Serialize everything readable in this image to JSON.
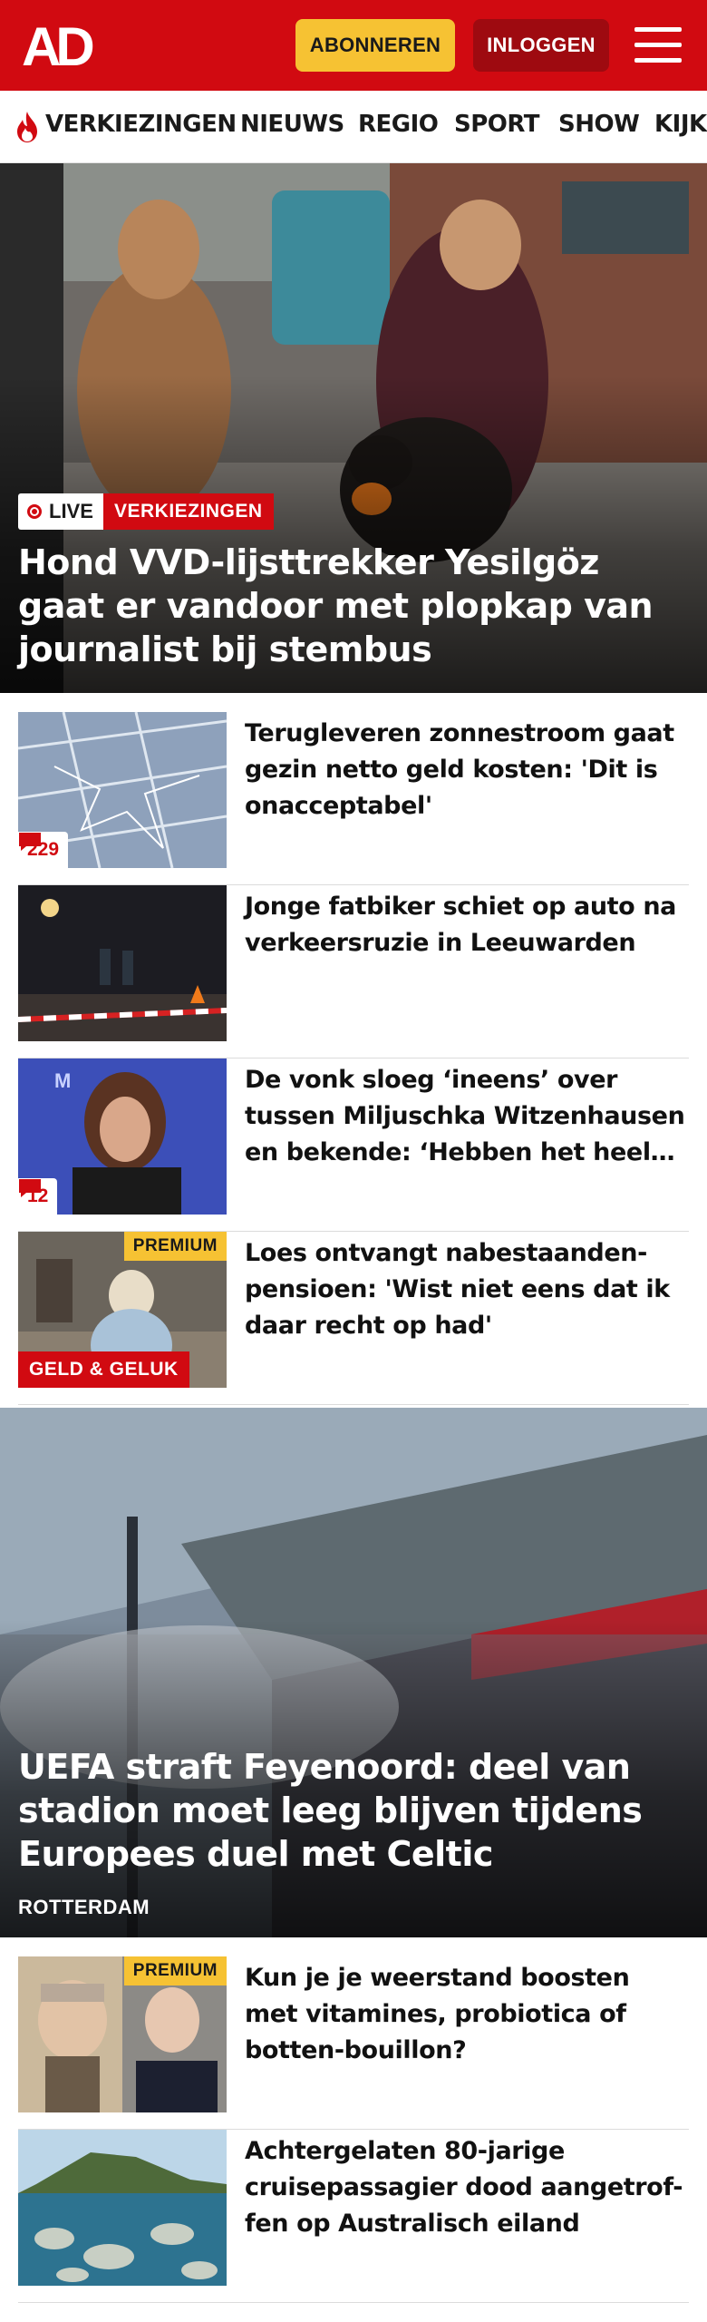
{
  "header": {
    "logo_text": "AD",
    "subscribe_label": "ABONNEREN",
    "login_label": "INLOGGEN",
    "colors": {
      "brand": "#d10a11",
      "subscribe": "#f6c233",
      "login": "#9e0a10"
    }
  },
  "nav": {
    "items": [
      {
        "label": "VERKIEZINGEN",
        "icon": "flame-icon"
      },
      {
        "label": "NIEUWS"
      },
      {
        "label": "REGIO"
      },
      {
        "label": "SPORT"
      },
      {
        "label": "SHOW"
      },
      {
        "label": "KIJK"
      }
    ]
  },
  "hero1": {
    "live_label": "LIVE",
    "category": "VERKIEZINGEN",
    "title": "Hond VVD-lijsttrekker Yesilgöz gaat er vandoor met plopkap van journalist bij stembus"
  },
  "articles": [
    {
      "title": "Terugleveren zonnestroom gaat gezin netto geld kosten: 'Dit is onacceptabel'",
      "comments": "229"
    },
    {
      "title": "Jonge fatbiker schiet op auto na verkeersruzie in Leeuwarden"
    },
    {
      "title": "De vonk sloeg ‘ineens’ over tussen Miljuschka Witzenhausen en bekende: ‘Hebben het heel…",
      "comments": "12"
    },
    {
      "title": "Loes ontvangt nabestaanden-pensioen: 'Wist niet eens dat ik daar recht op had'",
      "premium": "PREMIUM",
      "category": "GELD & GELUK"
    }
  ],
  "hero2": {
    "title": "UEFA straft Feyenoord: deel van stadion moet leeg blijven tijdens Europees duel met Celtic",
    "location": "ROTTERDAM"
  },
  "articles2": [
    {
      "title": "Kun je je weerstand boosten met vitamines, probiotica of botten-bouillon?",
      "premium": "PREMIUM"
    },
    {
      "title": "Achtergelaten 80-jarige cruisepassagier dood aangetrof-fen op Australisch eiland"
    }
  ]
}
